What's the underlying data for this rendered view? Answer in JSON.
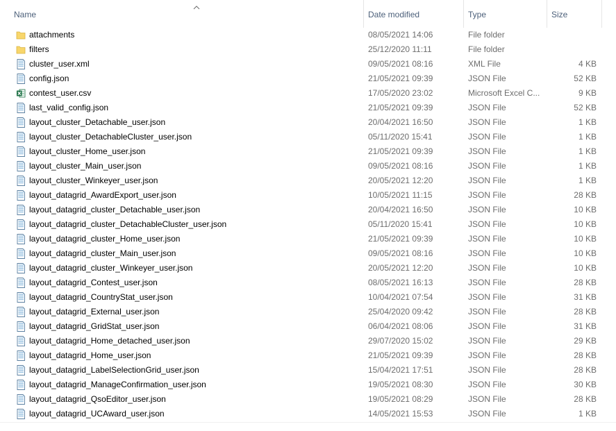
{
  "columns": {
    "name": "Name",
    "date_modified": "Date modified",
    "type": "Type",
    "size": "Size"
  },
  "sort": {
    "column": "name",
    "direction": "ascending",
    "icon": "chevron-up-icon"
  },
  "colors": {
    "folder": "#f8d66b",
    "json_file": "#9fc6e3",
    "excel": "#1d7044",
    "header_text": "#4c607a",
    "meta_text": "#6d6d6d"
  },
  "files": [
    {
      "name": "attachments",
      "date": "08/05/2021 14:06",
      "type": "File folder",
      "size": "",
      "icon": "folder-icon"
    },
    {
      "name": "filters",
      "date": "25/12/2020 11:11",
      "type": "File folder",
      "size": "",
      "icon": "folder-icon"
    },
    {
      "name": "cluster_user.xml",
      "date": "09/05/2021 08:16",
      "type": "XML File",
      "size": "4 KB",
      "icon": "document-icon"
    },
    {
      "name": "config.json",
      "date": "21/05/2021 09:39",
      "type": "JSON File",
      "size": "52 KB",
      "icon": "document-icon"
    },
    {
      "name": "contest_user.csv",
      "date": "17/05/2020 23:02",
      "type": "Microsoft Excel C...",
      "size": "9 KB",
      "icon": "excel-icon"
    },
    {
      "name": "last_valid_config.json",
      "date": "21/05/2021 09:39",
      "type": "JSON File",
      "size": "52 KB",
      "icon": "document-icon"
    },
    {
      "name": "layout_cluster_Detachable_user.json",
      "date": "20/04/2021 16:50",
      "type": "JSON File",
      "size": "1 KB",
      "icon": "document-icon"
    },
    {
      "name": "layout_cluster_DetachableCluster_user.json",
      "date": "05/11/2020 15:41",
      "type": "JSON File",
      "size": "1 KB",
      "icon": "document-icon"
    },
    {
      "name": "layout_cluster_Home_user.json",
      "date": "21/05/2021 09:39",
      "type": "JSON File",
      "size": "1 KB",
      "icon": "document-icon"
    },
    {
      "name": "layout_cluster_Main_user.json",
      "date": "09/05/2021 08:16",
      "type": "JSON File",
      "size": "1 KB",
      "icon": "document-icon"
    },
    {
      "name": "layout_cluster_Winkeyer_user.json",
      "date": "20/05/2021 12:20",
      "type": "JSON File",
      "size": "1 KB",
      "icon": "document-icon"
    },
    {
      "name": "layout_datagrid_AwardExport_user.json",
      "date": "10/05/2021 11:15",
      "type": "JSON File",
      "size": "28 KB",
      "icon": "document-icon"
    },
    {
      "name": "layout_datagrid_cluster_Detachable_user.json",
      "date": "20/04/2021 16:50",
      "type": "JSON File",
      "size": "10 KB",
      "icon": "document-icon"
    },
    {
      "name": "layout_datagrid_cluster_DetachableCluster_user.json",
      "date": "05/11/2020 15:41",
      "type": "JSON File",
      "size": "10 KB",
      "icon": "document-icon"
    },
    {
      "name": "layout_datagrid_cluster_Home_user.json",
      "date": "21/05/2021 09:39",
      "type": "JSON File",
      "size": "10 KB",
      "icon": "document-icon"
    },
    {
      "name": "layout_datagrid_cluster_Main_user.json",
      "date": "09/05/2021 08:16",
      "type": "JSON File",
      "size": "10 KB",
      "icon": "document-icon"
    },
    {
      "name": "layout_datagrid_cluster_Winkeyer_user.json",
      "date": "20/05/2021 12:20",
      "type": "JSON File",
      "size": "10 KB",
      "icon": "document-icon"
    },
    {
      "name": "layout_datagrid_Contest_user.json",
      "date": "08/05/2021 16:13",
      "type": "JSON File",
      "size": "28 KB",
      "icon": "document-icon"
    },
    {
      "name": "layout_datagrid_CountryStat_user.json",
      "date": "10/04/2021 07:54",
      "type": "JSON File",
      "size": "31 KB",
      "icon": "document-icon"
    },
    {
      "name": "layout_datagrid_External_user.json",
      "date": "25/04/2020 09:42",
      "type": "JSON File",
      "size": "28 KB",
      "icon": "document-icon"
    },
    {
      "name": "layout_datagrid_GridStat_user.json",
      "date": "06/04/2021 08:06",
      "type": "JSON File",
      "size": "31 KB",
      "icon": "document-icon"
    },
    {
      "name": "layout_datagrid_Home_detached_user.json",
      "date": "29/07/2020 15:02",
      "type": "JSON File",
      "size": "29 KB",
      "icon": "document-icon"
    },
    {
      "name": "layout_datagrid_Home_user.json",
      "date": "21/05/2021 09:39",
      "type": "JSON File",
      "size": "28 KB",
      "icon": "document-icon"
    },
    {
      "name": "layout_datagrid_LabelSelectionGrid_user.json",
      "date": "15/04/2021 17:51",
      "type": "JSON File",
      "size": "28 KB",
      "icon": "document-icon"
    },
    {
      "name": "layout_datagrid_ManageConfirmation_user.json",
      "date": "19/05/2021 08:30",
      "type": "JSON File",
      "size": "30 KB",
      "icon": "document-icon"
    },
    {
      "name": "layout_datagrid_QsoEditor_user.json",
      "date": "19/05/2021 08:29",
      "type": "JSON File",
      "size": "28 KB",
      "icon": "document-icon"
    },
    {
      "name": "layout_datagrid_UCAward_user.json",
      "date": "14/05/2021 15:53",
      "type": "JSON File",
      "size": "1 KB",
      "icon": "document-icon"
    }
  ]
}
